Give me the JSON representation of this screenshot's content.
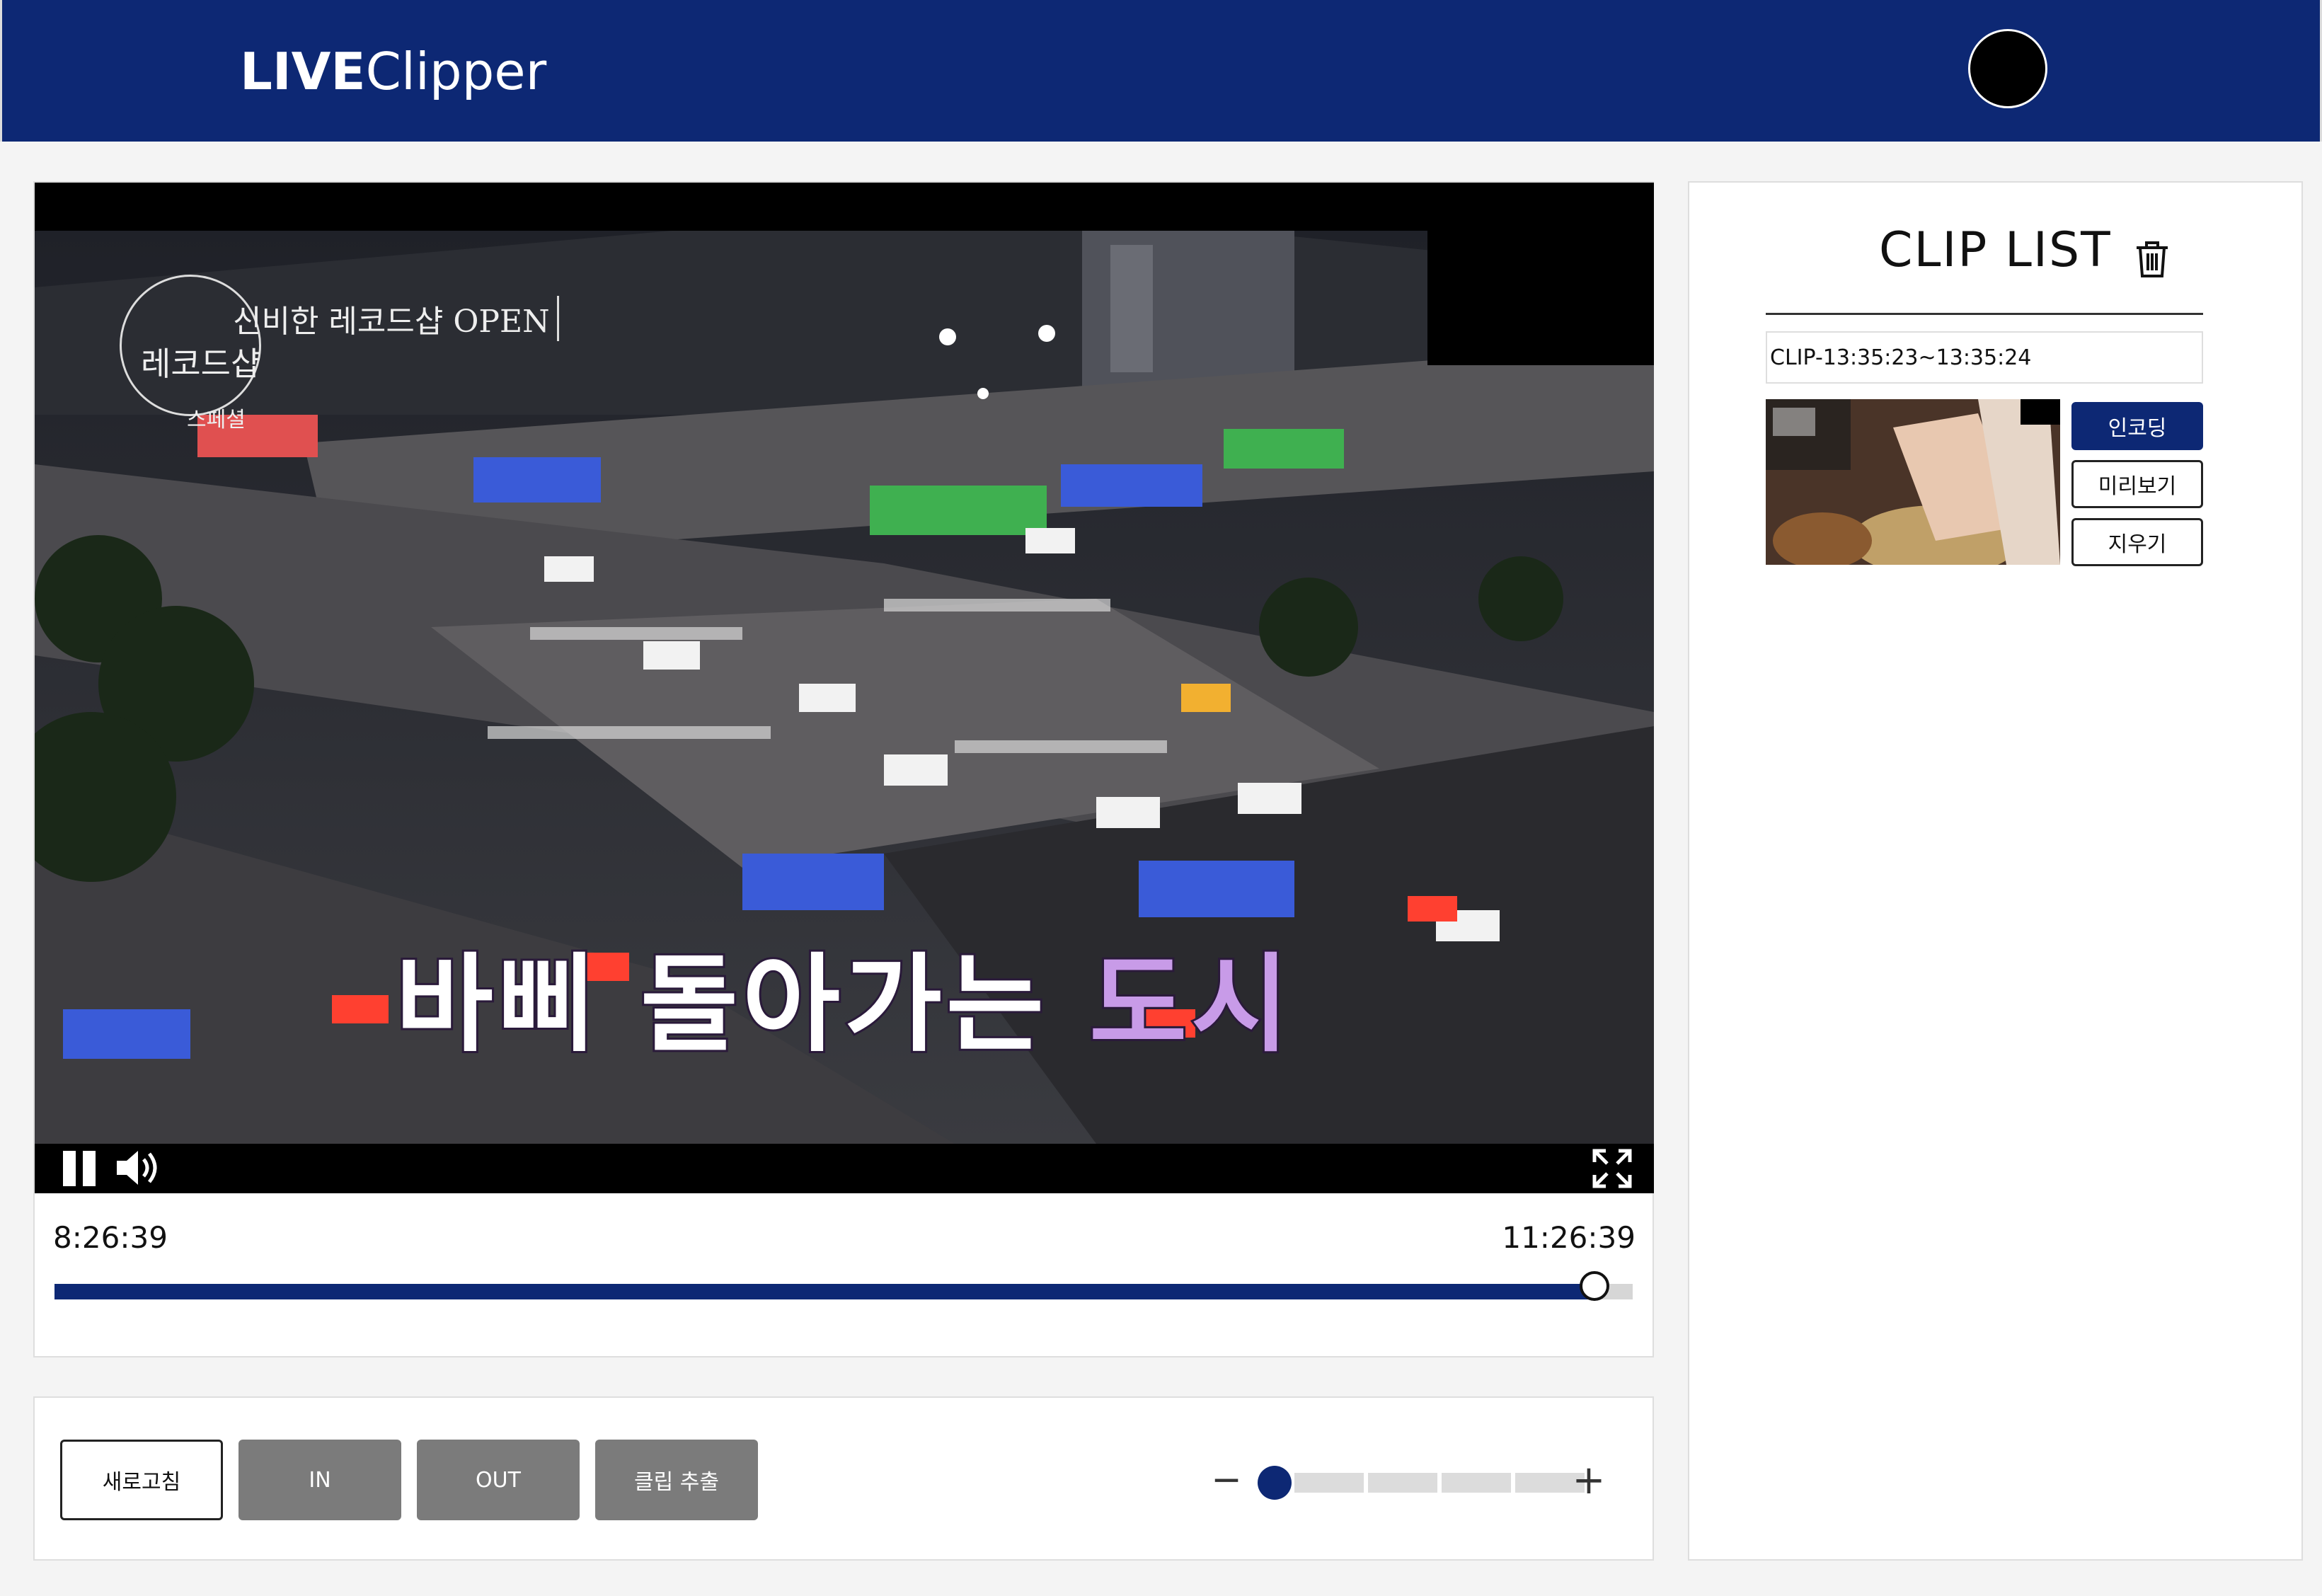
{
  "header": {
    "logo_bold": "LIVE",
    "logo_rest": "Clipper"
  },
  "video": {
    "badge_title": "신비한 레코드샵 OPEN",
    "badge_logo": "레코드샵",
    "badge_sub": "스페셜",
    "subtitle_white": "바삐 돌아가는 ",
    "subtitle_purple": "도시"
  },
  "timeline": {
    "start": "8:26:39",
    "end": "11:26:39",
    "progress": 0.976
  },
  "toolbar": {
    "refresh_label": "새로고침",
    "in_label": "IN",
    "out_label": "OUT",
    "extract_label": "클립 추출",
    "zoom_minus": "−",
    "zoom_plus": "+",
    "zoom_level": 1,
    "zoom_steps": 4
  },
  "clip_list": {
    "title": "CLIP LIST",
    "items": [
      {
        "name": "CLIP-13:35:23~13:35:24",
        "encode_label": "인코딩",
        "preview_label": "미리보기",
        "delete_label": "지우기"
      }
    ]
  },
  "colors": {
    "brand": "#0d2874",
    "button_gray": "#7b7b7b",
    "subtitle_purple": "#c89be8"
  },
  "icons": [
    "pause-icon",
    "volume-icon",
    "fullscreen-icon",
    "trash-icon"
  ]
}
